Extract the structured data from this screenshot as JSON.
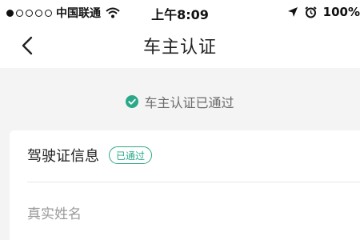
{
  "status_bar": {
    "carrier": "中国联通",
    "time": "上午8:09",
    "battery": "100%"
  },
  "nav": {
    "title": "车主认证"
  },
  "banner": {
    "text": "车主认证已通过"
  },
  "license_card": {
    "title": "驾驶证信息",
    "badge": "已通过",
    "fields": [
      {
        "label": "真实姓名"
      },
      {
        "label": ""
      }
    ]
  },
  "colors": {
    "accent": "#2ba889",
    "background": "#f4f4f4"
  }
}
